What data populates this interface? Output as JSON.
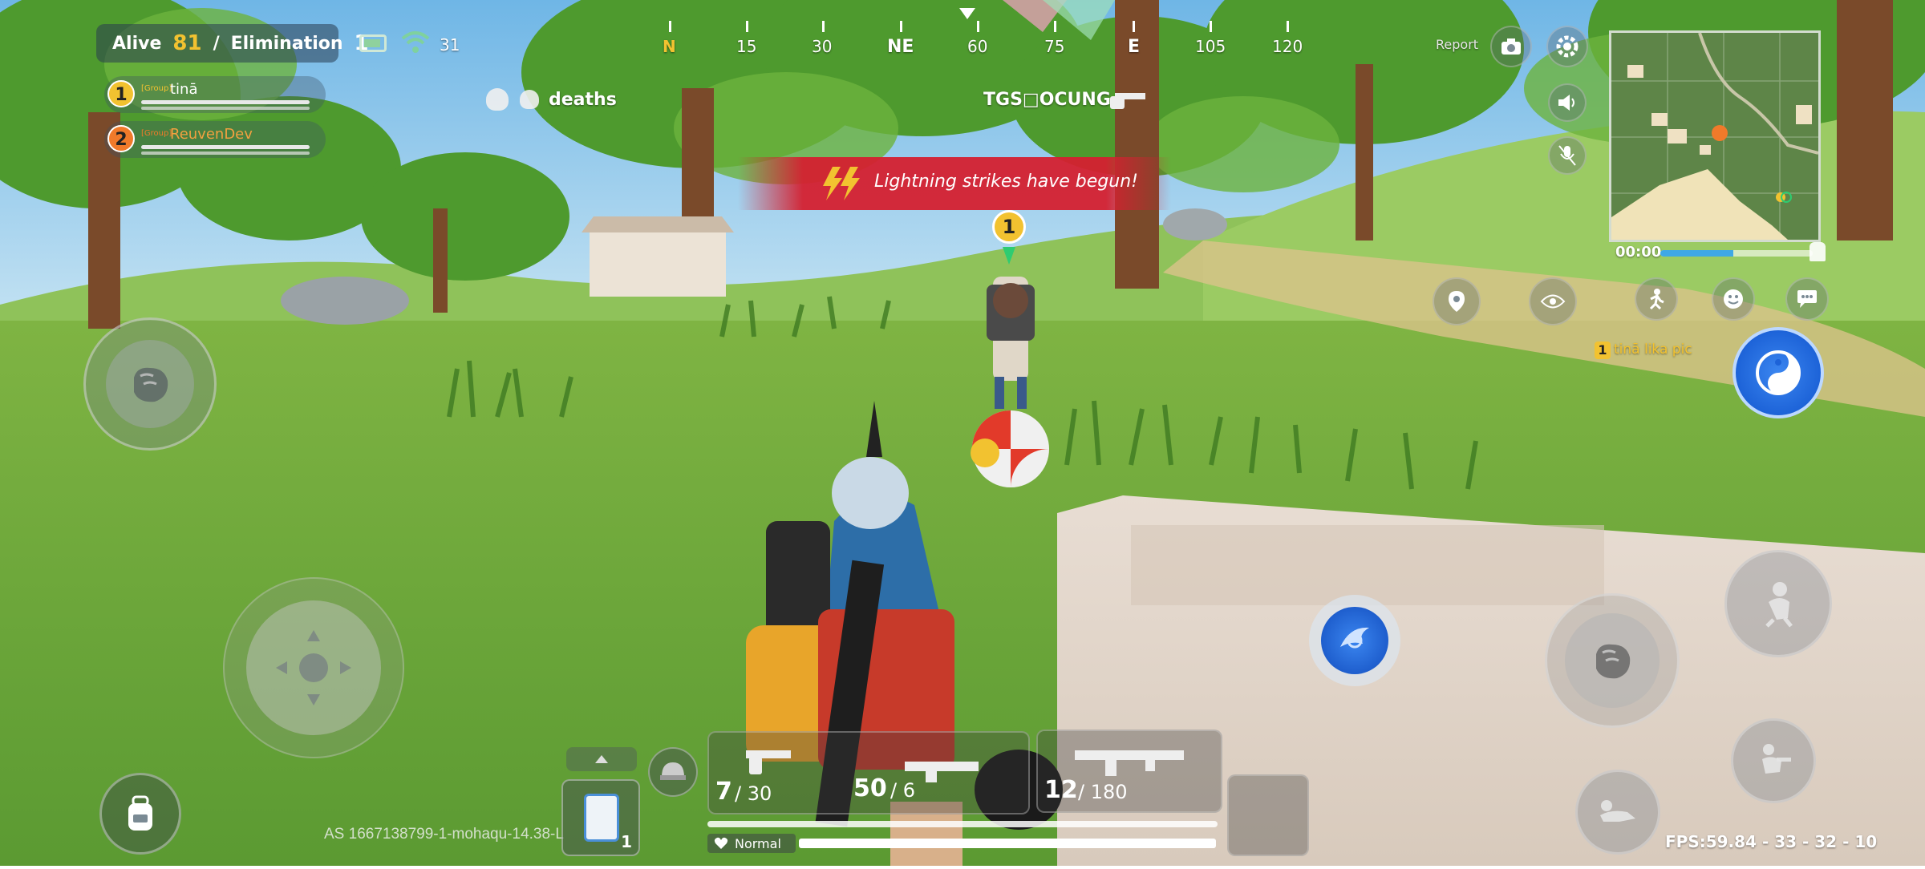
{
  "hud": {
    "alive_label": "Alive",
    "alive_count": "81",
    "separator": "/",
    "elimination_label": "Elimination",
    "elimination_count": "1",
    "ping": "31",
    "report_label": "Report",
    "deaths_label": "deaths",
    "enemy_tag": "TGS□OCUNG",
    "announcement": "Lightning strikes have begun!",
    "timer": "00:00",
    "fps": "FPS:59.84 - 33 - 32 - 10",
    "build_string": "AS  1667138799-1-mohaqu-14.38-L",
    "teammate_ping": "tinā lika pic",
    "health_state": "Normal"
  },
  "squad": [
    {
      "num": "1",
      "tag": "[Group]",
      "name": "tinā",
      "color": "#f2c230"
    },
    {
      "num": "2",
      "tag": "[Group]",
      "name": "ReuvenDev",
      "color": "#f07a2a"
    }
  ],
  "compass": [
    {
      "label": "N"
    },
    {
      "label": "15"
    },
    {
      "label": "30"
    },
    {
      "label": "NE"
    },
    {
      "label": "60"
    },
    {
      "label": "75"
    },
    {
      "label": "E"
    },
    {
      "label": "105"
    },
    {
      "label": "120"
    }
  ],
  "weapons": [
    {
      "ammo": "7",
      "reserve": "/ 30"
    },
    {
      "ammo": "50",
      "reserve": "/ 6"
    },
    {
      "ammo": "12",
      "reserve": "/ 180"
    }
  ],
  "inventory": {
    "count": "1"
  },
  "marker": {
    "num": "1"
  },
  "colors": {
    "accent_yellow": "#f2c230",
    "banner_red": "#d42030",
    "skill_blue": "#1d63d8"
  }
}
